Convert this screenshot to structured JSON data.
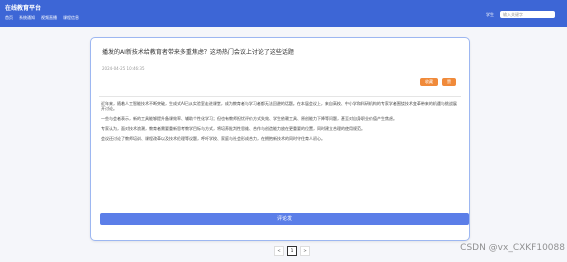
{
  "topbar": {
    "brand": "在线教育平台",
    "nav": [
      {
        "label": "首页"
      },
      {
        "label": "系统通知"
      },
      {
        "label": "视频直播"
      },
      {
        "label": "课程信息"
      }
    ],
    "user": "学生",
    "search_placeholder": "输入关键字"
  },
  "post": {
    "title": "播发的AI新技术给教育者带来多重焦虑？这场热门会议上讨论了这些话题",
    "time": "2024-04-25 10:46:35",
    "favorite_label": "收藏",
    "like_label": "赞",
    "paragraphs": [
      "近年来，随着人工智能技术不断突破，生成式AI已从实验室走进课堂，成为教育者与学习者都无法回避的话题。在本届会议上，来自高校、中小学和科研机构的专家学者围绕技术变革带来的机遇与挑战展开讨论。",
      "一些与会者表示，新的工具能够提升备课效率、辅助个性化学习；但也有教师担忧评价方式失效、学生依赖工具、原创能力下降等问题，甚至对自身职业价值产生焦虑。",
      "专家认为，面对技术浪潮，教育者需要重新思考教学目标与方式，将培养批判性思维、合作与创造能力放在更重要的位置，同时建立合理的使用规范。",
      "会议还讨论了教师培训、课程改革以及技术伦理等议题，呼吁学校、家庭与社会形成合力，在拥抱新技术的同时守住育人初心。"
    ]
  },
  "comment_button": "评论发",
  "pager": {
    "prev": "<",
    "current": "1",
    "next": ">"
  },
  "watermark": "CSDN @vx_CXKF10088"
}
